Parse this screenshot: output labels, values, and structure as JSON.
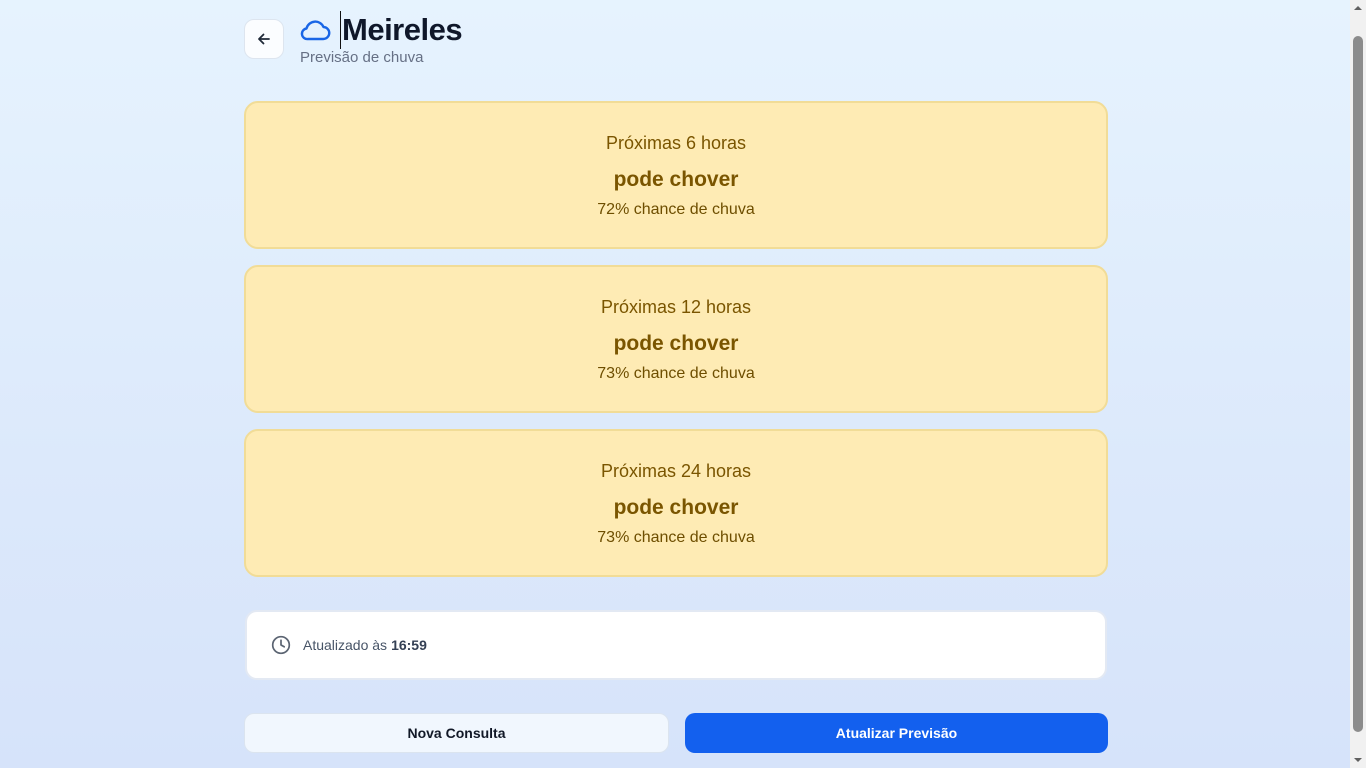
{
  "header": {
    "title": "Meireles",
    "subtitle": "Previsão de chuva",
    "back_icon": "arrow-left-icon",
    "title_icon": "cloud-icon"
  },
  "forecasts": [
    {
      "period": "Próximas 6 horas",
      "status": "pode chover",
      "chance": "72% chance de chuva"
    },
    {
      "period": "Próximas 12 horas",
      "status": "pode chover",
      "chance": "73% chance de chuva"
    },
    {
      "period": "Próximas 24 horas",
      "status": "pode chover",
      "chance": "73% chance de chuva"
    }
  ],
  "updated": {
    "label": "Atualizado às",
    "time": "16:59",
    "icon": "clock-icon"
  },
  "actions": {
    "new_query": "Nova Consulta",
    "refresh": "Atualizar Previsão"
  },
  "colors": {
    "card_background": "#feebb4",
    "card_text": "#7a5500",
    "primary": "#1360ee",
    "accent_icon": "#1a66e6"
  }
}
